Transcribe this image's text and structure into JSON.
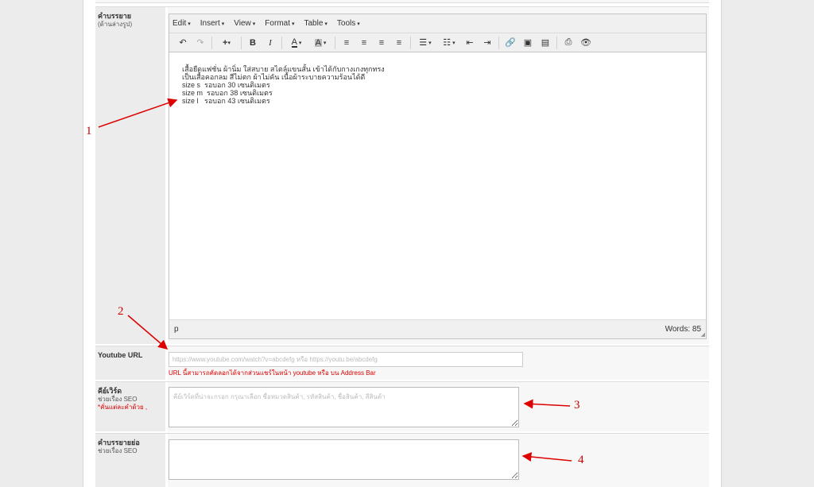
{
  "editor": {
    "label": "คำบรรยาย",
    "label_sub": "(ด้านล่างรูป)",
    "menus": [
      "Edit",
      "Insert",
      "View",
      "Format",
      "Table",
      "Tools"
    ],
    "content_lines": [
      "เสื้อยืดแฟชั่น ผ้านิ่ม ใส่สบาย สไตล์แขนสั้น เข้าได้กับกางเกงทุกทรง",
      "เป็นเสื้อคอกลม สีไม่ตก ผ้าไม่คัน เนื้อผ้าระบายความร้อนได้ดี",
      "size s  รอบอก 30 เซนติเมตร",
      "size m  รอบอก 38 เซนติเมตร",
      "size l   รอบอก 43 เซนติเมตร"
    ],
    "status_path": "p",
    "word_count": "Words: 85"
  },
  "youtube": {
    "label": "Youtube URL",
    "placeholder": "https://www.youtube.com/watch?v=abcdefg หรือ https://youtu.be/abcdefg",
    "hint": "URL นี้สามารถคัดลอกได้จากส่วนแชร์ในหน้า youtube หรือ บน Address Bar"
  },
  "keywords": {
    "label": "คีย์เวิร์ด",
    "sub": "ช่วยเรื่อง SEO",
    "required": "*คั่นแต่ละคำด้วย ,",
    "placeholder": "คีย์เวิร์ดที่น่าจะกรอก กรุณาเลือก ชื่อหมวดสินค้า, รหัสสินค้า, ชื่อสินค้า, สีสินค้า"
  },
  "short_desc": {
    "label": "คำบรรยายย่อ",
    "sub": "ช่วยเรื่อง SEO",
    "placeholder": ""
  },
  "annotations": [
    "1",
    "2",
    "3",
    "4"
  ]
}
